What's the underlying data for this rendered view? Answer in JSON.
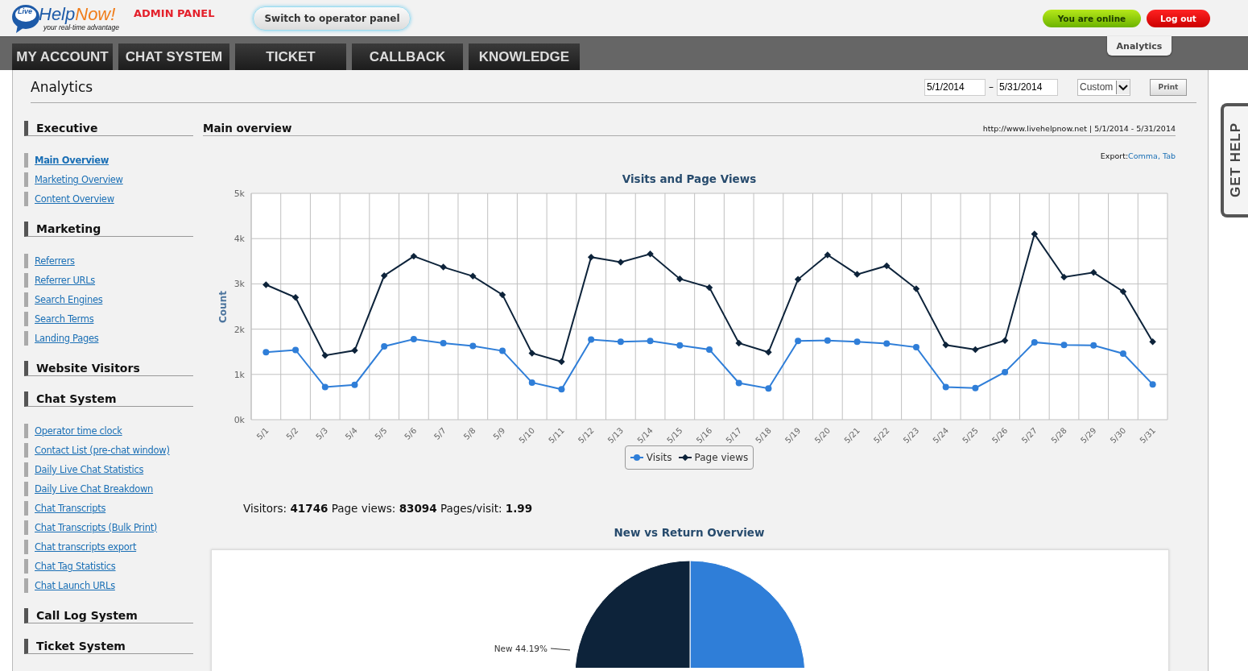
{
  "header": {
    "logo": {
      "bubble": "Live",
      "name_first": "Help",
      "name_second": "Now!",
      "tagline": "your real-time advantage"
    },
    "panel_label": "ADMIN PANEL",
    "switch_button": "Switch to operator panel",
    "status_button": "You are online",
    "logout_button": "Log out"
  },
  "nav": {
    "tabs": [
      {
        "label": "MY ACCOUNT"
      },
      {
        "label": "CHAT SYSTEM"
      },
      {
        "label": "TICKET"
      },
      {
        "label": "CALLBACK"
      },
      {
        "label": "KNOWLEDGE"
      }
    ],
    "subtab": "Analytics"
  },
  "page": {
    "title": "Analytics",
    "date_from": "5/1/2014",
    "date_separator": "–",
    "date_to": "5/31/2014",
    "range_select": "Custom",
    "print_button": "Print"
  },
  "sidebar": [
    {
      "heading": "Executive",
      "items": [
        {
          "label": "Main Overview",
          "selected": true
        },
        {
          "label": "Marketing Overview",
          "selected": false
        },
        {
          "label": "Content Overview",
          "selected": false
        }
      ]
    },
    {
      "heading": "Marketing",
      "items": [
        {
          "label": "Referrers",
          "selected": false
        },
        {
          "label": "Referrer URLs",
          "selected": false
        },
        {
          "label": "Search Engines",
          "selected": false
        },
        {
          "label": "Search Terms",
          "selected": false
        },
        {
          "label": "Landing Pages",
          "selected": false
        }
      ]
    },
    {
      "heading": "Website Visitors"
    },
    {
      "heading": "Chat System",
      "items": [
        {
          "label": "Operator time clock",
          "selected": false
        },
        {
          "label": "Contact List (pre-chat window)",
          "selected": false
        },
        {
          "label": "Daily Live Chat Statistics",
          "selected": false
        },
        {
          "label": "Daily Live Chat Breakdown",
          "selected": false
        },
        {
          "label": "Chat Transcripts",
          "selected": false
        },
        {
          "label": "Chat Transcripts (Bulk Print)",
          "selected": false
        },
        {
          "label": "Chat transcripts export",
          "selected": false
        },
        {
          "label": "Chat Tag Statistics",
          "selected": false
        },
        {
          "label": "Chat Launch URLs",
          "selected": false
        }
      ]
    },
    {
      "heading": "Call Log System"
    },
    {
      "heading": "Ticket System"
    }
  ],
  "main": {
    "heading": "Main overview",
    "meta": "http://www.livehelpnow.net | 5/1/2014 - 5/31/2014",
    "export_label": "Export:",
    "export_links": [
      "Comma",
      "Tab"
    ],
    "export_separator": ",",
    "visits_chart": {
      "chart_data": {
        "type": "line",
        "title": "Visits and Page Views",
        "ylabel": "Count",
        "categories": [
          "5/1",
          "5/2",
          "5/3",
          "5/4",
          "5/5",
          "5/6",
          "5/7",
          "5/8",
          "5/9",
          "5/10",
          "5/11",
          "5/12",
          "5/13",
          "5/14",
          "5/15",
          "5/16",
          "5/17",
          "5/18",
          "5/19",
          "5/20",
          "5/21",
          "5/22",
          "5/23",
          "5/24",
          "5/25",
          "5/26",
          "5/27",
          "5/28",
          "5/29",
          "5/30",
          "5/31"
        ],
        "ylim": [
          0,
          5000
        ],
        "grid": true,
        "yticks": [
          {
            "value": 0,
            "label": "0k"
          },
          {
            "value": 1000,
            "label": "1k"
          },
          {
            "value": 2000,
            "label": "2k"
          },
          {
            "value": 3000,
            "label": "3k"
          },
          {
            "value": 4000,
            "label": "4k"
          },
          {
            "value": 5000,
            "label": "5k"
          }
        ],
        "series": [
          {
            "name": "Visits",
            "color": "#2f7ed8",
            "marker": "circle",
            "values": [
              1490,
              1540,
              720,
              770,
              1620,
              1780,
              1690,
              1630,
              1520,
              820,
              670,
              1770,
              1720,
              1740,
              1640,
              1550,
              810,
              690,
              1740,
              1750,
              1720,
              1680,
              1600,
              720,
              700,
              1050,
              1710,
              1650,
              1640,
              1460,
              780
            ]
          },
          {
            "name": "Page views",
            "color": "#0d233a",
            "marker": "diamond",
            "values": [
              2980,
              2700,
              1420,
              1530,
              3180,
              3610,
              3370,
              3170,
              2760,
              1470,
              1280,
              3590,
              3480,
              3660,
              3110,
              2920,
              1690,
              1490,
              3100,
              3640,
              3210,
              3400,
              2890,
              1650,
              1550,
              1750,
              4100,
              3150,
              3250,
              2830,
              1720
            ]
          }
        ]
      }
    },
    "stats": "Visitors: **41746** Page views: **83094** Pages/visit: **1.99**",
    "pie_chart": {
      "chart_data": {
        "type": "pie",
        "title": "New vs Return Overview",
        "values": [
          44.19,
          55.81
        ],
        "colors": [
          "#0d233a",
          "#2f7ed8"
        ],
        "value_labels": [
          "New 44.19%",
          null
        ]
      }
    }
  },
  "help_tab": "GET HELP"
}
